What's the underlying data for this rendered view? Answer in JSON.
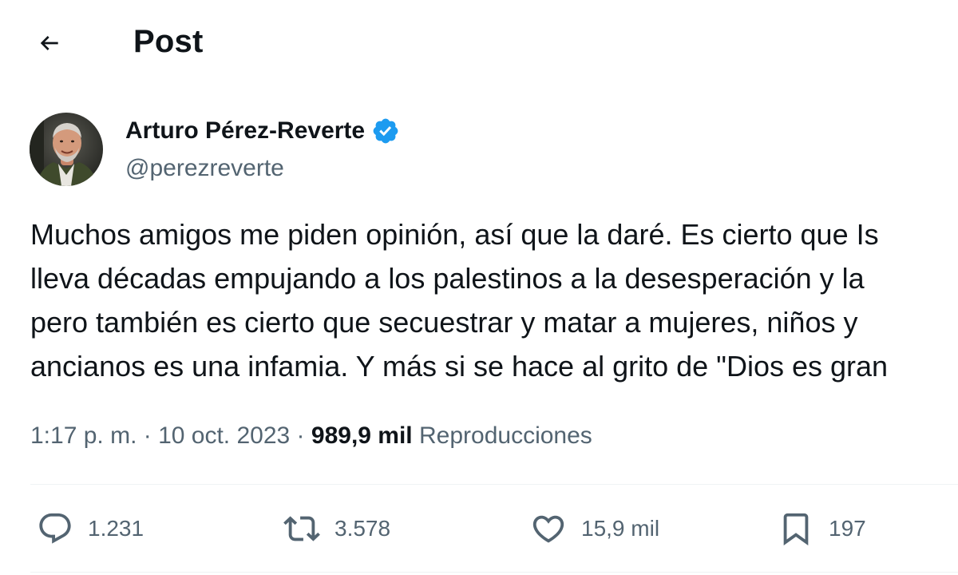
{
  "header": {
    "title": "Post",
    "back_icon": "arrow-left-icon"
  },
  "author": {
    "name": "Arturo Pérez-Reverte",
    "handle": "@perezreverte",
    "verified": true,
    "verified_color": "#1d9bf0"
  },
  "tweet": {
    "lines": [
      "Muchos amigos me piden opinión, así que la daré. Es cierto que Is",
      "lleva décadas empujando a los palestinos a la desesperación y la",
      "pero también es cierto que secuestrar y matar a mujeres, niños y",
      "ancianos es una infamia. Y más si se hace al grito de \"Dios es gran"
    ]
  },
  "meta": {
    "time": "1:17 p. m.",
    "separator": " · ",
    "date": "10 oct. 2023",
    "views_count": "989,9 mil",
    "views_label": "Reproducciones"
  },
  "actions": {
    "replies": {
      "icon": "reply-icon",
      "count": "1.231"
    },
    "reposts": {
      "icon": "repost-icon",
      "count": "3.578"
    },
    "likes": {
      "icon": "heart-icon",
      "count": "15,9 mil"
    },
    "bookmarks": {
      "icon": "bookmark-icon",
      "count": "197"
    }
  },
  "colors": {
    "text_primary": "#0f1419",
    "text_secondary": "#536471",
    "divider": "#eff3f4",
    "accent": "#1d9bf0"
  }
}
